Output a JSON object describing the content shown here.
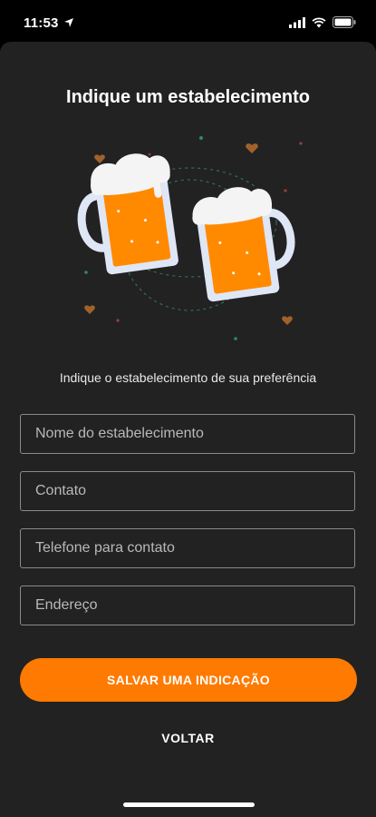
{
  "status_bar": {
    "time": "11:53",
    "icons": [
      "location-arrow-icon",
      "cellular-signal-icon",
      "wifi-icon",
      "battery-icon"
    ]
  },
  "page": {
    "title": "Indique um estabelecimento",
    "subtitle": "Indique o estabelecimento de sua preferência"
  },
  "form": {
    "name_placeholder": "Nome do estabelecimento",
    "contact_placeholder": "Contato",
    "phone_placeholder": "Telefone para contato",
    "address_placeholder": "Endereço"
  },
  "actions": {
    "save_label": "SALVAR UMA INDICAÇÃO",
    "back_label": "VOLTAR"
  },
  "colors": {
    "accent": "#ff7a00",
    "background": "#222222",
    "border": "#8a8a8a"
  },
  "illustration": {
    "icon": "beer-mugs-toast-icon"
  }
}
